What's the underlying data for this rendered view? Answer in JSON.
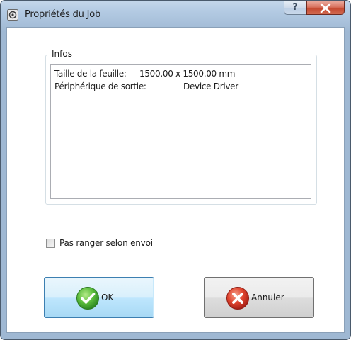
{
  "window": {
    "title": "Propriétés du Job",
    "help_label": "?",
    "icons": [
      "app-icon",
      "help-icon",
      "close-icon"
    ]
  },
  "infos": {
    "group_title": "Infos",
    "rows": [
      {
        "label": "Taille de la feuille:",
        "value": "1500.00 x 1500.00 mm"
      },
      {
        "label": "Périphérique de sortie:",
        "value": "Device Driver"
      }
    ]
  },
  "options": {
    "no_sort_label": "Pas ranger selon envoi",
    "no_sort_checked": false
  },
  "buttons": {
    "ok_label": "OK",
    "ok_icon": "check-icon",
    "cancel_label": "Annuler",
    "cancel_icon": "cancel-icon"
  },
  "colors": {
    "ok_accent": "#3faa3c",
    "cancel_accent": "#d8352a",
    "title_bar": "#b4cbe3"
  }
}
